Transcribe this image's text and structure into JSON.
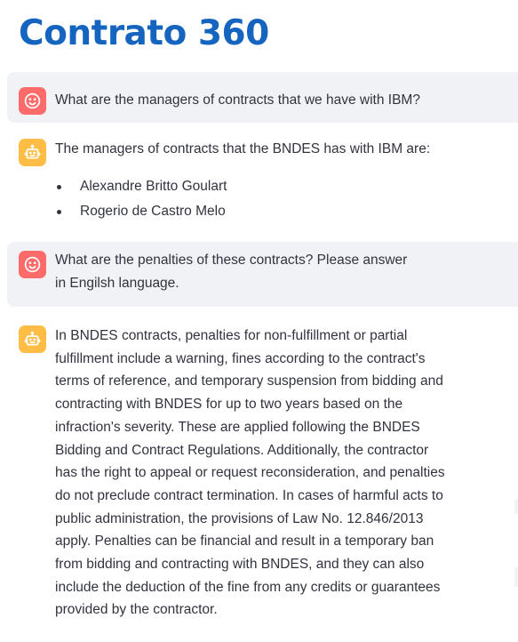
{
  "app": {
    "title": "Contrato 360"
  },
  "chat": {
    "messages": [
      {
        "role": "user",
        "avatar_icon": "smiley-face-icon",
        "text": "What are the managers of contracts that we have with IBM?"
      },
      {
        "role": "assistant",
        "avatar_icon": "robot-icon",
        "text": "The managers of contracts that the BNDES has with IBM are:",
        "list": [
          "Alexandre Britto Goulart",
          "Rogerio de Castro Melo"
        ]
      },
      {
        "role": "user",
        "avatar_icon": "smiley-face-icon",
        "text": "What are the penalties of these contracts? Please answer in Engilsh language."
      },
      {
        "role": "assistant",
        "avatar_icon": "robot-icon",
        "text": "In BNDES contracts, penalties for non-fulfillment or partial fulfillment include a warning, fines according to the contract's terms of reference, and temporary suspension from bidding and contracting with BNDES for up to two years based on the infraction's severity. These are applied following the BNDES Bidding and Contract Regulations. Additionally, the contractor has the right to appeal or request reconsideration, and penalties do not preclude contract termination. In cases of harmful acts to public administration, the provisions of Law No. 12.846/2013 apply. Penalties can be financial and result in a temporary ban from bidding and contracting with BNDES, and they can also include the deduction of the fine from any credits or guarantees provided by the contractor."
      }
    ]
  },
  "colors": {
    "title": "#1565c0",
    "user_avatar": "#ff6b6b",
    "assistant_avatar": "#ffbd45",
    "user_message_bg": "#f0f2f6",
    "text": "#31333f"
  }
}
